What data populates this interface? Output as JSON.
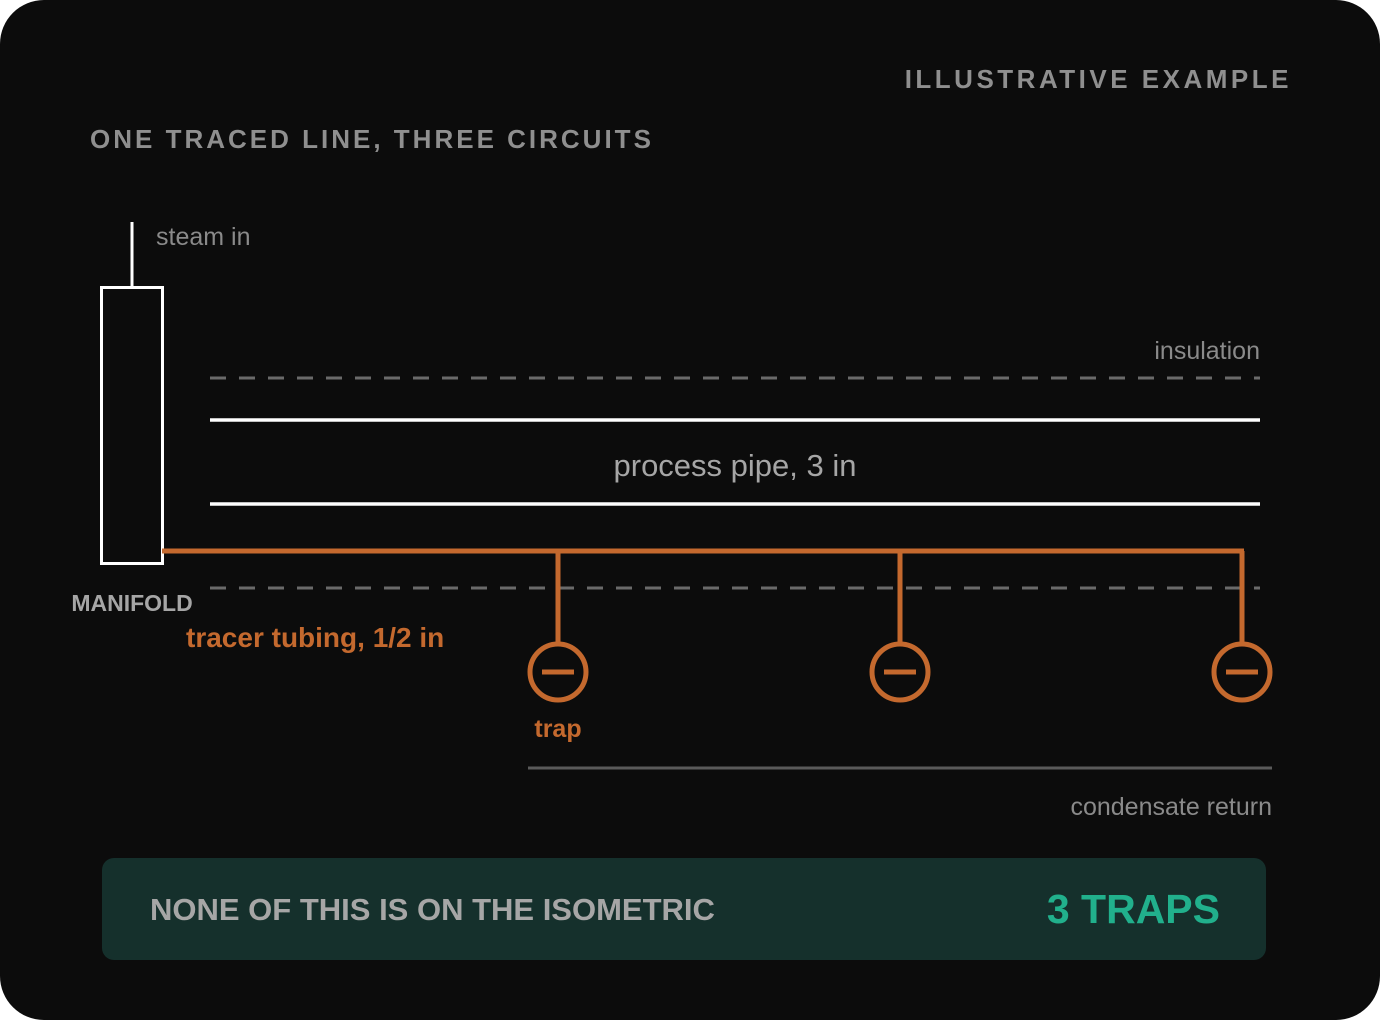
{
  "header": {
    "eyebrow": "ILLUSTRATIVE EXAMPLE",
    "title": "ONE TRACED LINE, THREE CIRCUITS"
  },
  "diagram": {
    "steam_in_label": "steam in",
    "manifold_label": "MANIFOLD",
    "insulation_label": "insulation",
    "pipe_label": "process pipe, 3 in",
    "tracer_label": "tracer tubing, 1/2 in",
    "trap_label": "trap",
    "condensate_label": "condensate return",
    "trap_count": 3
  },
  "footer": {
    "note": "NONE OF THIS IS ON THE ISOMETRIC",
    "count": "3 TRAPS"
  },
  "colors": {
    "background": "#0c0c0c",
    "muted_text": "#8f8f8f",
    "line_white": "#ffffff",
    "tracer_orange": "#c4692e",
    "footer_bg": "#15302c",
    "accent_green": "#21b08c"
  }
}
